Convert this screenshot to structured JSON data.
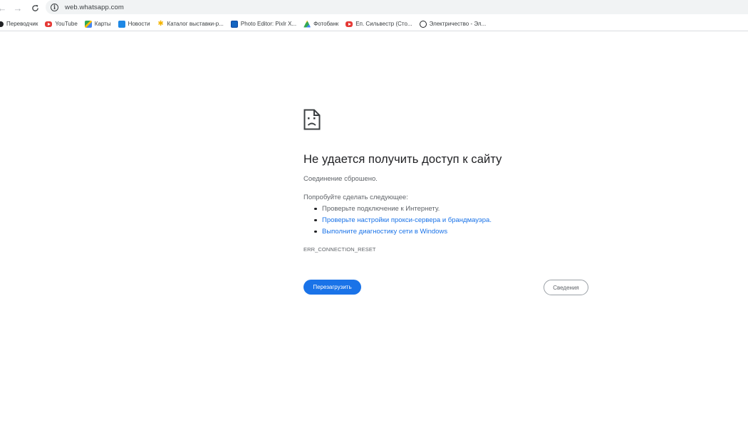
{
  "browser": {
    "url": "web.whatsapp.com",
    "bookmarks": [
      {
        "label": "Переводчик",
        "icon": "translate-icon"
      },
      {
        "label": "YouTube",
        "icon": "youtube-icon"
      },
      {
        "label": "Карты",
        "icon": "maps-icon"
      },
      {
        "label": "Новости",
        "icon": "news-icon"
      },
      {
        "label": "Каталог выставки-р...",
        "icon": "star-icon"
      },
      {
        "label": "Photo Editor: Pixlr X...",
        "icon": "pixlr-icon"
      },
      {
        "label": "Фотобанк",
        "icon": "google-drive-icon"
      },
      {
        "label": "Еп. Сильвестр (Сто...",
        "icon": "youtube-icon"
      },
      {
        "label": "Электричество - Эл...",
        "icon": "site-icon"
      }
    ]
  },
  "error": {
    "title": "Не удается получить доступ к сайту",
    "description": "Соединение сброшено.",
    "try_heading": "Попробуйте сделать следующее:",
    "suggestions": [
      "Проверьте подключение к Интернету.",
      "Проверьте настройки прокси-сервера и брандмауэра.",
      "Выполните диагностику сети в Windows"
    ],
    "code": "ERR_CONNECTION_RESET",
    "reload_label": "Перезагрузить",
    "details_label": "Сведения"
  },
  "colors": {
    "primary": "#1a73e8",
    "text": "#202124",
    "secondary_text": "#5f6368"
  }
}
